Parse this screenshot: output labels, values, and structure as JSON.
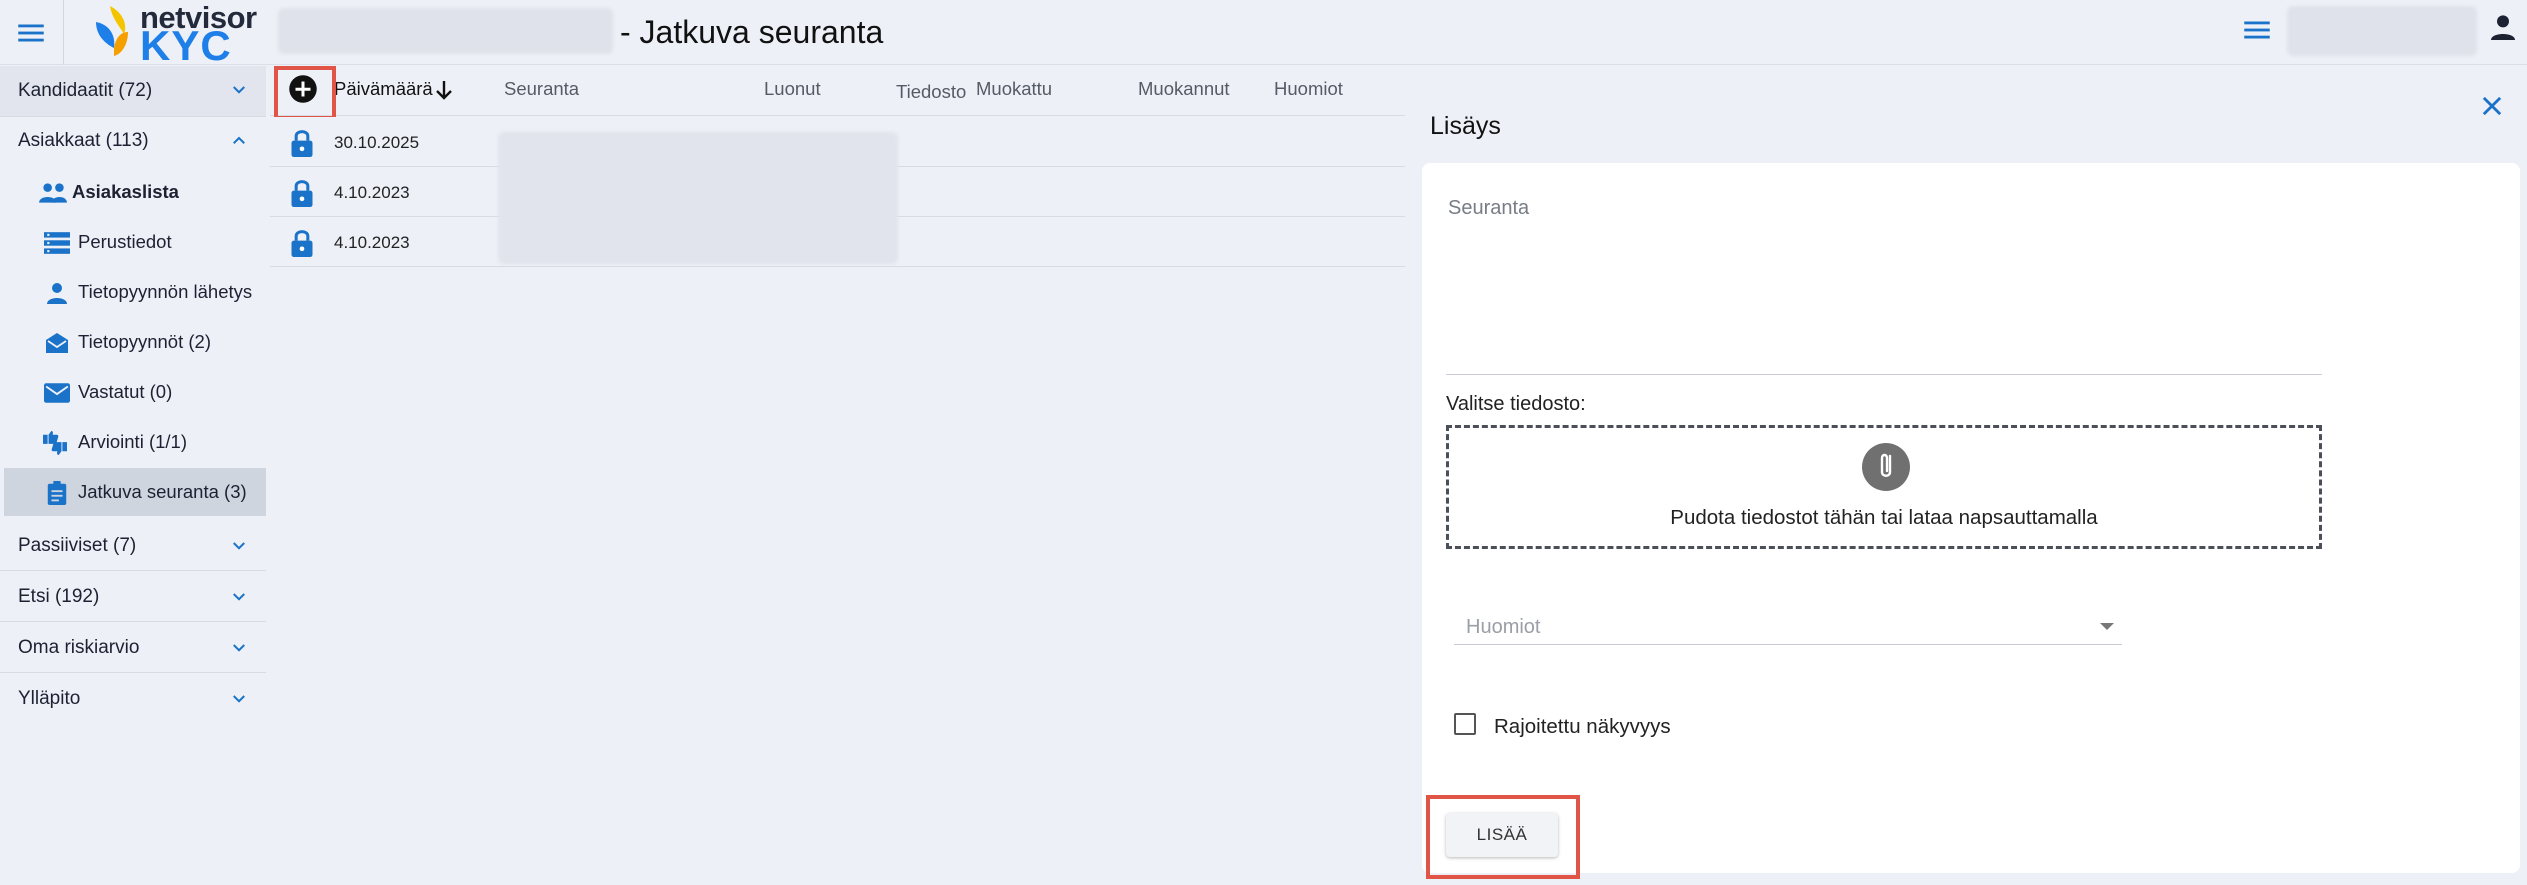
{
  "header": {
    "logo_top": "netvisor",
    "logo_bottom": "KYC",
    "page_title": "- Jatkuva seuranta"
  },
  "sidebar": {
    "sections": [
      {
        "label": "Kandidaatit (72)"
      },
      {
        "label": "Asiakkaat (113)"
      },
      {
        "label": "Passiiviset (7)"
      },
      {
        "label": "Etsi (192)"
      },
      {
        "label": "Oma riskiarvio"
      },
      {
        "label": "Ylläpito"
      }
    ],
    "items": [
      {
        "label": "Asiakaslista",
        "icon": "people-icon"
      },
      {
        "label": "Perustiedot",
        "icon": "list-icon"
      },
      {
        "label": "Tietopyynnön lähetys",
        "icon": "person-icon"
      },
      {
        "label": "Tietopyynnöt (2)",
        "icon": "open-mail-icon"
      },
      {
        "label": "Vastatut (0)",
        "icon": "mail-icon"
      },
      {
        "label": "Arviointi (1/1)",
        "icon": "thumbs-icon"
      },
      {
        "label": "Jatkuva seuranta (3)",
        "icon": "clipboard-icon"
      }
    ]
  },
  "table": {
    "columns": [
      "Päivämäärä",
      "Seuranta",
      "Luonut",
      "Tiedosto",
      "Muokattu",
      "Muokannut",
      "Huomiot"
    ],
    "rows": [
      {
        "date": "30.10.2025"
      },
      {
        "date": "4.10.2023"
      },
      {
        "date": "4.10.2023"
      }
    ]
  },
  "panel": {
    "title": "Lisäys",
    "seuranta_label": "Seuranta",
    "file_label": "Valitse tiedosto:",
    "drop_text": "Pudota tiedostot tähän tai lataa napsauttamalla",
    "huomiot_placeholder": "Huomiot",
    "checkbox_label": "Rajoitettu näkyvyys",
    "submit_label": "LISÄÄ"
  },
  "colors": {
    "accent": "#1e7fe8",
    "icon_blue": "#1a73c8",
    "highlight": "#e05545",
    "background": "#eef0f7"
  }
}
